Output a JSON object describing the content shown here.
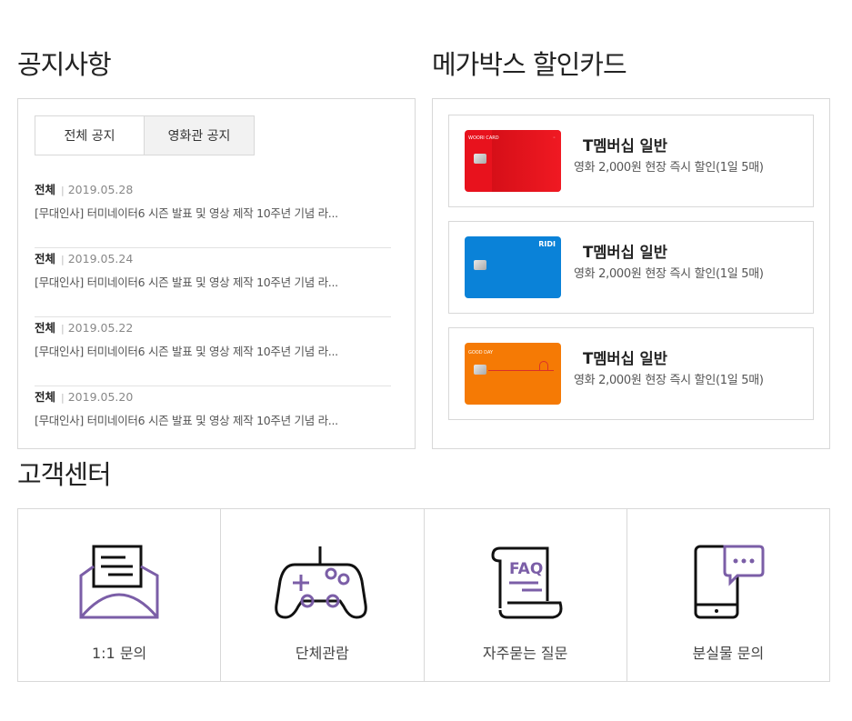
{
  "notice": {
    "title": "공지사항",
    "tabs": [
      "전체 공지",
      "영화관 공지"
    ],
    "items": [
      {
        "category": "전체",
        "date": "2019.05.28",
        "title": "[무대인사] 터미네이터6 시즌 발표 및 영상 제작 10주년 기념 라..."
      },
      {
        "category": "전체",
        "date": "2019.05.24",
        "title": "[무대인사] 터미네이터6 시즌 발표 및 영상 제작 10주년 기념 라..."
      },
      {
        "category": "전체",
        "date": "2019.05.22",
        "title": "[무대인사] 터미네이터6 시즌 발표 및 영상 제작 10주년 기념 라..."
      },
      {
        "category": "전체",
        "date": "2019.05.20",
        "title": "[무대인사] 터미네이터6 시즌 발표 및 영상 제작 10주년 기념 라..."
      }
    ]
  },
  "cards": {
    "title": "메가박스 할인카드",
    "items": [
      {
        "name": "T멤버십 일반",
        "desc": "영화 2,000원 현장 즉시 할인(1일 5매)",
        "color": "#e8121d",
        "brand": "WOORI CARD"
      },
      {
        "name": "T멤버십 일반",
        "desc": "영화 2,000원 현장 즉시 할인(1일 5매)",
        "color": "#0a82d8",
        "brand": "RIDI"
      },
      {
        "name": "T멤버십 일반",
        "desc": "영화 2,000원 현장 즉시 할인(1일 5매)",
        "color": "#f57a05",
        "brand": "GOOD DAY"
      }
    ]
  },
  "support": {
    "title": "고객센터",
    "accent": "#7b5ea7",
    "items": [
      {
        "label": "1:1 문의",
        "icon": "envelope-icon"
      },
      {
        "label": "단체관람",
        "icon": "gamepad-icon"
      },
      {
        "label": "자주묻는 질문",
        "icon": "faq-scroll-icon"
      },
      {
        "label": "분실물 문의",
        "icon": "phone-chat-icon"
      }
    ]
  }
}
